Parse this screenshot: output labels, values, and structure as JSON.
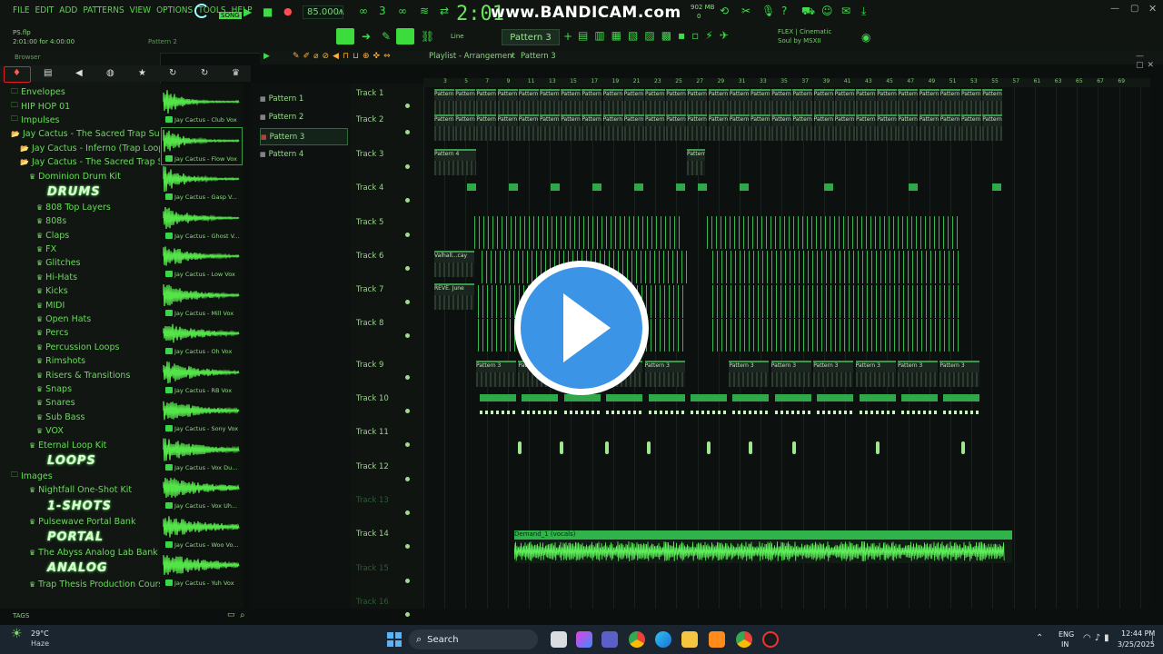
{
  "menu": [
    "FILE",
    "EDIT",
    "ADD",
    "PATTERNS",
    "VIEW",
    "OPTIONS",
    "TOOLS",
    "HELP"
  ],
  "transport": {
    "mode": "SONG",
    "tempo": "85.000",
    "clock": "2:01",
    "memory": "902 MB",
    "memory_sub": "0"
  },
  "watermark": "www.BANDICAM.com",
  "project": {
    "file": "PS.flp",
    "position": "2:01:00 for 4:00:00",
    "pattern_hint": "Pattern 2"
  },
  "toolbar": {
    "snap": "Line",
    "pattern_select": "Pattern 3"
  },
  "news": {
    "line1": "FLEX | Cinematic",
    "line2": "Soul by MSXII"
  },
  "browser": {
    "title": "Browser",
    "items": [
      {
        "label": "Envelopes",
        "type": "folder"
      },
      {
        "label": "HIP HOP 01",
        "type": "folder"
      },
      {
        "label": "Impulses",
        "type": "folder"
      },
      {
        "label": "Jay Cactus - The Sacred Trap Suite",
        "type": "open"
      },
      {
        "label": "Jay Cactus - Inferno (Trap Loop Kit)",
        "type": "open"
      },
      {
        "label": "Jay Cactus - The Sacred Trap Suite",
        "type": "open"
      },
      {
        "label": "Dominion Drum Kit",
        "type": "pack"
      },
      {
        "label": "DRUMS",
        "type": "logo"
      },
      {
        "label": "808 Top Layers",
        "type": "sub"
      },
      {
        "label": "808s",
        "type": "sub"
      },
      {
        "label": "Claps",
        "type": "sub"
      },
      {
        "label": "FX",
        "type": "sub"
      },
      {
        "label": "Glitches",
        "type": "sub"
      },
      {
        "label": "Hi-Hats",
        "type": "sub"
      },
      {
        "label": "Kicks",
        "type": "sub"
      },
      {
        "label": "MIDI",
        "type": "sub"
      },
      {
        "label": "Open Hats",
        "type": "sub"
      },
      {
        "label": "Percs",
        "type": "sub"
      },
      {
        "label": "Percussion Loops",
        "type": "sub"
      },
      {
        "label": "Rimshots",
        "type": "sub"
      },
      {
        "label": "Risers & Transitions",
        "type": "sub"
      },
      {
        "label": "Snaps",
        "type": "sub"
      },
      {
        "label": "Snares",
        "type": "sub"
      },
      {
        "label": "Sub Bass",
        "type": "sub"
      },
      {
        "label": "VOX",
        "type": "sub"
      },
      {
        "label": "Eternal Loop Kit",
        "type": "pack"
      },
      {
        "label": "LOOPS",
        "type": "logo"
      },
      {
        "label": "Images",
        "type": "folder"
      },
      {
        "label": "Nightfall One-Shot Kit",
        "type": "pack"
      },
      {
        "label": "1-SHOTS",
        "type": "logo"
      },
      {
        "label": "Pulsewave Portal Bank",
        "type": "pack"
      },
      {
        "label": "PORTAL",
        "type": "logo"
      },
      {
        "label": "The Abyss Analog Lab Bank",
        "type": "pack"
      },
      {
        "label": "ANALOG",
        "type": "logo"
      },
      {
        "label": "Trap Thesis Production Course",
        "type": "pack"
      }
    ],
    "tags": "TAGS"
  },
  "samples": [
    "Jay Cactus - Club Vox",
    "Jay Cactus - Flow Vox",
    "Jay Cactus - Gasp V...",
    "Jay Cactus - Ghost V...",
    "Jay Cactus - Low Vox",
    "Jay Cactus - Mill Vox",
    "Jay Cactus - Oh Vox",
    "Jay Cactus - RB Vox",
    "Jay Cactus - Sony Vox",
    "Jay Cactus - Vox Du...",
    "Jay Cactus - Vox Uh...",
    "Jay Cactus - Woo Vo...",
    "Jay Cactus - Yuh Vox"
  ],
  "patterns": [
    "Pattern 1",
    "Pattern 2",
    "Pattern 3",
    "Pattern 4"
  ],
  "playlist": {
    "title": "Playlist - Arrangement",
    "pattern": "Pattern 3"
  },
  "tracks": [
    "Track 1",
    "Track 2",
    "Track 3",
    "Track 4",
    "Track 5",
    "Track 6",
    "Track 7",
    "Track 8",
    "Track 9",
    "Track 10",
    "Track 11",
    "Track 12",
    "Track 13",
    "Track 14",
    "Track 15",
    "Track 16"
  ],
  "ruler": [
    "3",
    "5",
    "7",
    "9",
    "11",
    "13",
    "15",
    "17",
    "19",
    "21",
    "23",
    "25",
    "27",
    "29",
    "31",
    "33",
    "35",
    "37",
    "39",
    "41",
    "43",
    "45",
    "47",
    "49",
    "51",
    "53",
    "55",
    "57",
    "61",
    "63",
    "65",
    "67",
    "69"
  ],
  "clips": {
    "pattern1": "Pattern 1",
    "pattern2": "Pattern 2",
    "pattern3": "Pattern 3",
    "pattern4": "Pattern 4",
    "valhalla": "Valhall...cay",
    "reve": "REVE. June",
    "audio": "Demand_1 (vocals)",
    "pattern_short": "Pat...n 1"
  },
  "taskbar": {
    "weather_temp": "29°C",
    "weather_desc": "Haze",
    "search": "Search",
    "lang1": "ENG",
    "lang2": "IN",
    "time": "12:44 PM",
    "date": "3/25/2025"
  },
  "colors": {
    "accent": "#3fdc4a",
    "bg": "#0b0f0d",
    "play": "#3b94e6"
  }
}
